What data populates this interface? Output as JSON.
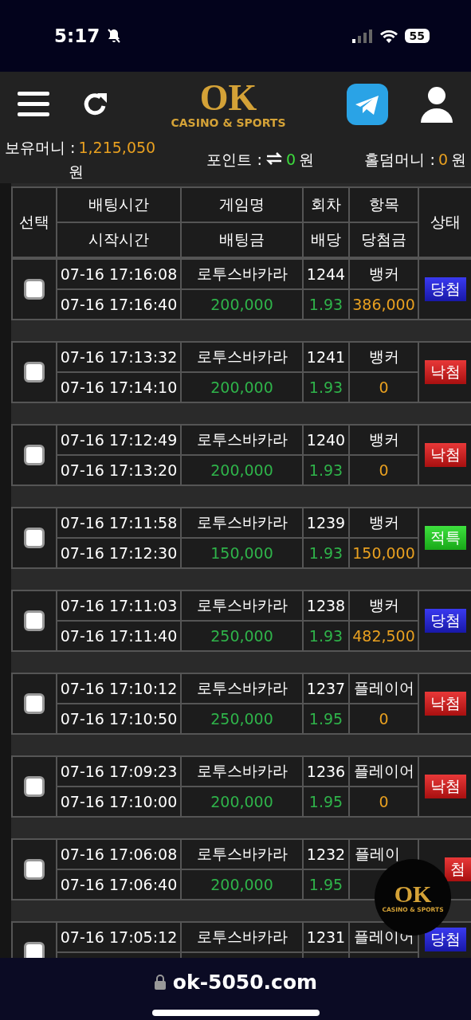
{
  "status_bar": {
    "time": "5:17",
    "battery": "55"
  },
  "header": {
    "logo": {
      "mark": "OK",
      "tagline": "CASINO & SPORTS"
    }
  },
  "balances": [
    {
      "kind": "money",
      "label": "보유머니 :",
      "value": "1,215,050",
      "unit": "원",
      "color": "#e8a020"
    },
    {
      "kind": "point",
      "label": "포인트 :",
      "value": "0",
      "unit": "원",
      "color": "#3ddc3d"
    },
    {
      "kind": "money",
      "label": "홀덤머니 :",
      "value": "0",
      "unit": "원",
      "color": "#e8a020"
    }
  ],
  "table": {
    "columns": [
      {
        "top": "선택"
      },
      {
        "top": "배팅시간",
        "bottom": "시작시간"
      },
      {
        "top": "게임명",
        "bottom": "배팅금"
      },
      {
        "top": "회차",
        "bottom": "배당"
      },
      {
        "top": "항목",
        "bottom": "당첨금"
      },
      {
        "top": "상태"
      }
    ],
    "rows": [
      {
        "checked": false,
        "bet_time": "07-16 17:16:08",
        "start_time": "07-16 17:16:40",
        "game": "로투스바카라",
        "amount": "200,000",
        "round": "1244",
        "odds": "1.93",
        "pick": "뱅커",
        "payout": "386,000",
        "status": {
          "kind": "win",
          "text": "당첨"
        }
      },
      {
        "checked": false,
        "bet_time": "07-16 17:13:32",
        "start_time": "07-16 17:14:10",
        "game": "로투스바카라",
        "amount": "200,000",
        "round": "1241",
        "odds": "1.93",
        "pick": "뱅커",
        "payout": "0",
        "status": {
          "kind": "lose",
          "text": "낙첨"
        }
      },
      {
        "checked": false,
        "bet_time": "07-16 17:12:49",
        "start_time": "07-16 17:13:20",
        "game": "로투스바카라",
        "amount": "200,000",
        "round": "1240",
        "odds": "1.93",
        "pick": "뱅커",
        "payout": "0",
        "status": {
          "kind": "lose",
          "text": "낙첨"
        }
      },
      {
        "checked": false,
        "bet_time": "07-16 17:11:58",
        "start_time": "07-16 17:12:30",
        "game": "로투스바카라",
        "amount": "150,000",
        "round": "1239",
        "odds": "1.93",
        "pick": "뱅커",
        "payout": "150,000",
        "status": {
          "kind": "refund",
          "text": "적특"
        }
      },
      {
        "checked": false,
        "bet_time": "07-16 17:11:03",
        "start_time": "07-16 17:11:40",
        "game": "로투스바카라",
        "amount": "250,000",
        "round": "1238",
        "odds": "1.93",
        "pick": "뱅커",
        "payout": "482,500",
        "status": {
          "kind": "win",
          "text": "당첨"
        }
      },
      {
        "checked": false,
        "bet_time": "07-16 17:10:12",
        "start_time": "07-16 17:10:50",
        "game": "로투스바카라",
        "amount": "250,000",
        "round": "1237",
        "odds": "1.95",
        "pick": "플레이어",
        "payout": "0",
        "status": {
          "kind": "lose",
          "text": "낙첨"
        }
      },
      {
        "checked": false,
        "bet_time": "07-16 17:09:23",
        "start_time": "07-16 17:10:00",
        "game": "로투스바카라",
        "amount": "200,000",
        "round": "1236",
        "odds": "1.95",
        "pick": "플레이어",
        "payout": "0",
        "status": {
          "kind": "lose",
          "text": "낙첨"
        }
      },
      {
        "checked": false,
        "bet_time": "07-16 17:06:08",
        "start_time": "07-16 17:06:40",
        "game": "로투스바카라",
        "amount": "200,000",
        "round": "1232",
        "odds": "1.95",
        "pick": "플레이",
        "status": {
          "kind": "lose",
          "text": "첨"
        }
      },
      {
        "checked": false,
        "bet_time": "07-16 17:05:12",
        "game": "로투스바카라",
        "round": "1231",
        "pick": "플레이어",
        "status": {
          "kind": "win",
          "text": "당첨"
        }
      }
    ]
  },
  "floating_logo": {
    "mark": "OK",
    "tagline": "CASINO & SPORTS"
  },
  "address_bar": {
    "url": "ok-5050.com"
  }
}
